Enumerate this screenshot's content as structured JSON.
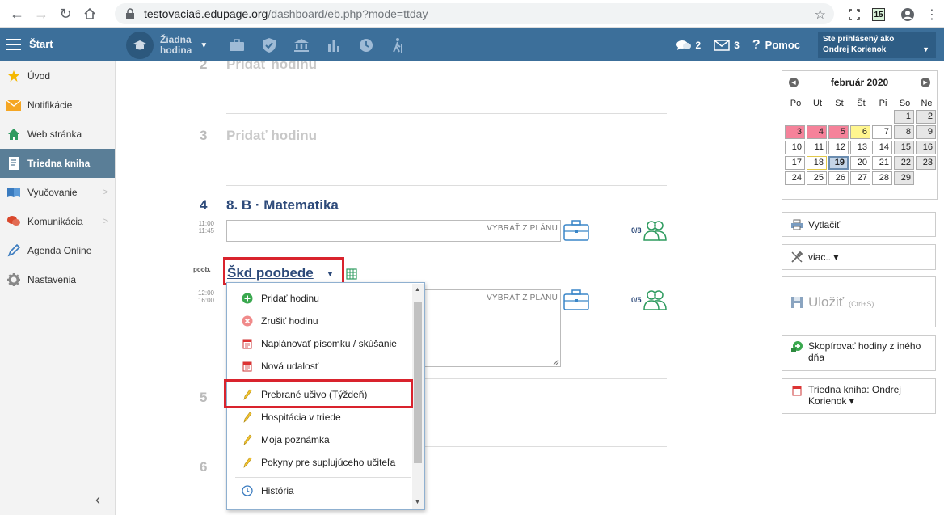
{
  "browser": {
    "url_host": "testovacia6.edupage.org",
    "url_path": "/dashboard/eb.php?mode=ttday",
    "ext_calendar": "15"
  },
  "header": {
    "menu_label": "Štart",
    "lesson_line1": "Žiadna",
    "lesson_line2": "hodina",
    "messages_count": "2",
    "mail_count": "3",
    "help_label": "Pomoc",
    "user_line1": "Ste prihlásený ako",
    "user_line2": "Ondrej Korienok"
  },
  "sidebar": {
    "items": [
      {
        "label": "Úvod"
      },
      {
        "label": "Notifikácie"
      },
      {
        "label": "Web stránka"
      },
      {
        "label": "Triedna kniha"
      },
      {
        "label": "Vyučovanie"
      },
      {
        "label": "Komunikácia"
      },
      {
        "label": "Agenda Online"
      },
      {
        "label": "Nastavenia"
      }
    ]
  },
  "lessons": {
    "l2_num": "2",
    "l2_add": "Pridať hodinu",
    "l3_num": "3",
    "l3_add": "Pridať hodinu",
    "l4_num": "4",
    "l4_subject": "8. B · Matematika",
    "l4_time_start": "11:00",
    "l4_time_end": "11:45",
    "l4_plan_placeholder": "VYBRAŤ Z PLÁNU",
    "l4_count": "0/8",
    "poob_label": "poob.",
    "skd_subject": "Škd poobede",
    "skd_time_start": "12:00",
    "skd_time_end": "16:00",
    "skd_plan_placeholder": "VYBRAŤ Z PLÁNU",
    "skd_count": "0/5",
    "l5_num": "5",
    "l6_num": "6"
  },
  "dropdown": {
    "items": [
      {
        "label": "Pridať hodinu"
      },
      {
        "label": "Zrušiť hodinu"
      },
      {
        "label": "Naplánovať písomku / skúšanie"
      },
      {
        "label": "Nová udalosť"
      },
      {
        "label": "Prebrané učivo (Týždeň)"
      },
      {
        "label": "Hospitácia v triede"
      },
      {
        "label": "Moja poznámka"
      },
      {
        "label": "Pokyny pre suplujúceho učiteľa"
      },
      {
        "label": "História"
      }
    ]
  },
  "calendar": {
    "month": "február 2020",
    "dow": [
      "Po",
      "Ut",
      "St",
      "Št",
      "Pi",
      "So",
      "Ne"
    ],
    "weeks": [
      [
        "",
        "",
        "",
        "",
        "",
        "1",
        "2"
      ],
      [
        "3",
        "4",
        "5",
        "6",
        "7",
        "8",
        "9"
      ],
      [
        "10",
        "11",
        "12",
        "13",
        "14",
        "15",
        "16"
      ],
      [
        "17",
        "18",
        "19",
        "20",
        "21",
        "22",
        "23"
      ],
      [
        "24",
        "25",
        "26",
        "27",
        "28",
        "29",
        ""
      ]
    ],
    "styles": [
      [
        "empty",
        "empty",
        "empty",
        "empty",
        "empty",
        "gray",
        "gray"
      ],
      [
        "pink",
        "pink",
        "pink",
        "yellow",
        "",
        "gray",
        "gray"
      ],
      [
        "",
        "",
        "",
        "",
        "",
        "gray",
        "gray"
      ],
      [
        "",
        "yellowb",
        "today",
        "",
        "",
        "gray",
        "gray"
      ],
      [
        "",
        "",
        "",
        "",
        "",
        "gray",
        "empty"
      ]
    ],
    "colors": {
      "pink": "#f5829a",
      "yellow": "#fff68f",
      "today": "#c5d6e8"
    }
  },
  "right_panel": {
    "print_label": "Vytlačiť",
    "more_label": "viac.. ▾",
    "save_label": "Uložiť",
    "save_shortcut": "(Ctrl+S)",
    "copy_label": "Skopírovať hodiny z iného dňa",
    "book_label": "Triedna kniha: Ondrej Korienok ▾"
  },
  "colors": {
    "header": "#3c6f9a",
    "active_sidebar": "#5a7e97",
    "highlight": "#d9232d",
    "subject": "#2d4a7a"
  }
}
